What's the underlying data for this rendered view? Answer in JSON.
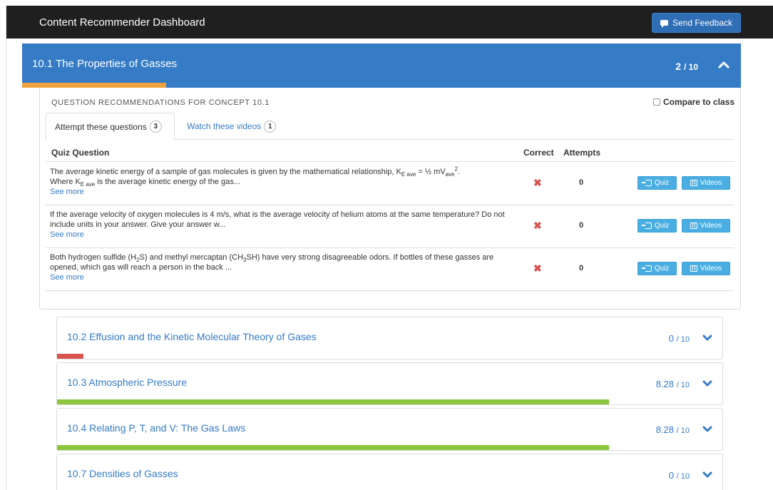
{
  "topbar": {
    "title": "Content Recommender Dashboard",
    "feedback_label": "Send Feedback"
  },
  "active_concept": {
    "title": "10.1  The Properties of Gasses",
    "score": "2",
    "score_total": "/ 10",
    "progress_fraction": 0.2,
    "progress_color": "#f0a23c",
    "header_color": "#357bc6"
  },
  "panel": {
    "heading": "QUESTION RECOMMENDATIONS FOR CONCEPT 10.1",
    "compare_label": "Compare to class",
    "tabs": [
      {
        "label": "Attempt these questions",
        "count": "3"
      },
      {
        "label": "Watch these videos",
        "count": "1"
      }
    ],
    "columns": {
      "question": "Quiz Question",
      "correct": "Correct",
      "attempts": "Attempts"
    },
    "quiz_label": "Quiz",
    "videos_label": "Videos",
    "see_more": "See more",
    "rows": [
      {
        "attempts": "0",
        "correct": "✖"
      },
      {
        "attempts": "0",
        "correct": "✖"
      },
      {
        "attempts": "0",
        "correct": "✖"
      }
    ]
  },
  "questions_text": {
    "q1_a": "The average kinetic energy of a sample of gas molecules is given by the mathematical relationship, K",
    "q1_sub1": "E ave",
    "q1_b": " = ½ mV",
    "q1_sub2": "ave",
    "q1_sup": "2",
    "q1_c": ".",
    "q1_d": "Where K",
    "q1_sub3": "E ave",
    "q1_e": " is the average kinetic energy of the gas...",
    "q2": "If the average velocity of oxygen molecules is 4 m/s, what is the average velocity of helium atoms at the same temperature? Do not include units in your answer. Give your answer w...",
    "q3_a": "Both hydrogen sulfide (H",
    "q3_s1": "2",
    "q3_b": "S) and methyl mercaptan (CH",
    "q3_s2": "3",
    "q3_c": "SH) have very strong disagreeable odors. If bottles of these gasses are opened, which gas will reach a person in the back ..."
  },
  "concepts": [
    {
      "title": "10.2  Effusion and the Kinetic Molecular Theory of Gases",
      "score": "0",
      "total": "/ 10",
      "progress_fraction": 0.04,
      "bar_color": "#d9534f"
    },
    {
      "title": "10.3  Atmospheric Pressure",
      "score": "8.28",
      "total": "/ 10",
      "progress_fraction": 0.828,
      "bar_color": "#8cc63f"
    },
    {
      "title": "10.4  Relating P, T, and V: The Gas Laws",
      "score": "8.28",
      "total": "/ 10",
      "progress_fraction": 0.828,
      "bar_color": "#8cc63f"
    },
    {
      "title": "10.7  Densities of Gasses",
      "score": "0",
      "total": "/ 10",
      "progress_fraction": 0.04,
      "bar_color": "#d9534f"
    }
  ]
}
